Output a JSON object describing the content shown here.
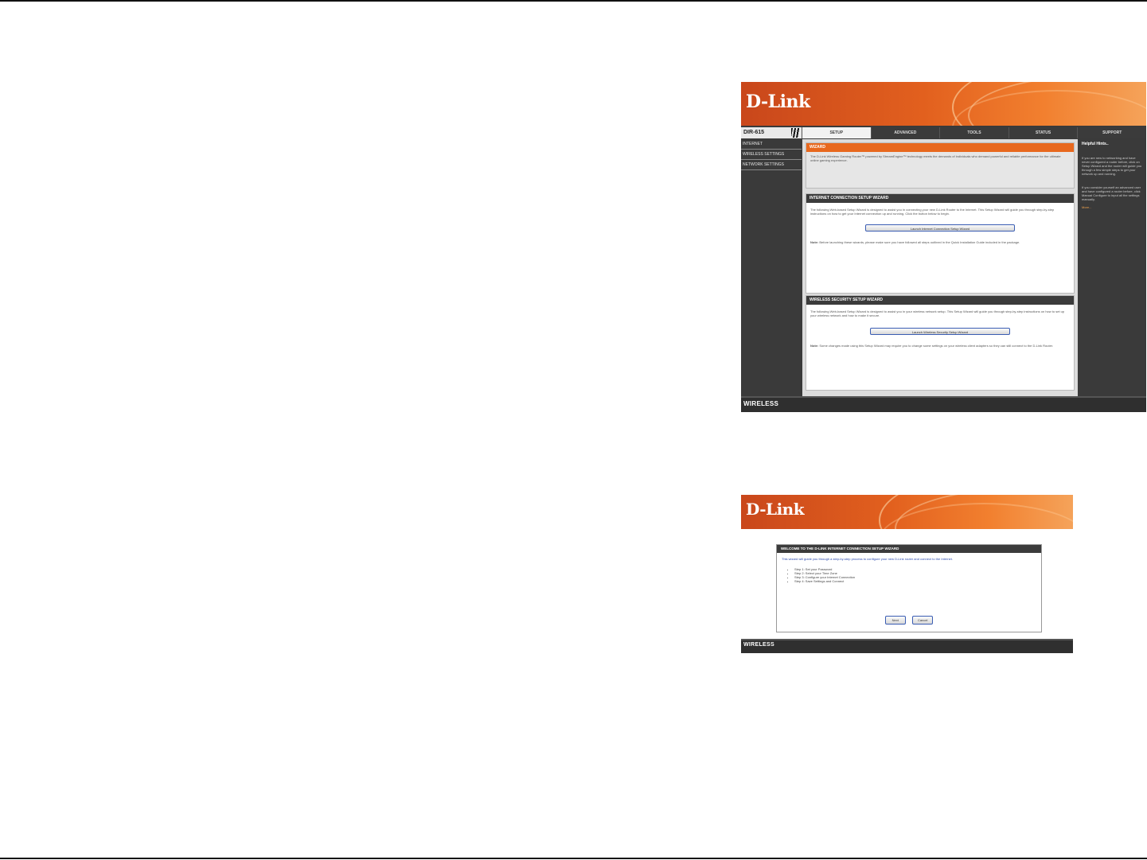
{
  "screenshot_1": {
    "brand": "D-Link",
    "model": "DIR-615",
    "tabs": [
      "SETUP",
      "ADVANCED",
      "TOOLS",
      "STATUS",
      "SUPPORT"
    ],
    "active_tab": "SETUP",
    "sidebar": [
      "INTERNET",
      "WIRELESS SETTINGS",
      "NETWORK SETTINGS"
    ],
    "wizard": {
      "title": "WIZARD",
      "text": "The D-Link Wireless Gaming Router™ powered by StreamEngine™ technology meets the demands of individuals who demand powerful and reliable performance for the ultimate online gaming experience."
    },
    "internet_wizard": {
      "title": "INTERNET CONNECTION SETUP WIZARD",
      "text": "The following Web-based Setup Wizard is designed to assist you in connecting your new D-Link Router to the Internet. This Setup Wizard will guide you through step-by-step instructions on how to get your Internet connection up and running. Click the button below to begin.",
      "button": "Launch Internet Connection Setup Wizard",
      "note_label": "Note:",
      "note": "Before launching these wizards, please make sure you have followed all steps outlined in the Quick Installation Guide included in the package."
    },
    "wireless_wizard": {
      "title": "WIRELESS SECURITY SETUP WIZARD",
      "text": "The following Web-based Setup Wizard is designed to assist you in your wireless network setup. This Setup Wizard will guide you through step-by-step instructions on how to set up your wireless network and how to make it secure.",
      "button": "Launch Wireless Security Setup Wizard",
      "note_label": "Note:",
      "note": "Some changes made using this Setup Wizard may require you to change some settings on your wireless client adapters so they can still connect to the D-Link Router."
    },
    "helpful_hints": {
      "title": "Helpful Hints..",
      "p1": "If you are new to networking and have never configured a router before, click on Setup Wizard and the router will guide you through a few simple steps to get your network up and running.",
      "p2": "If you consider yourself an advanced user and have configured a router before, click Manual Configure to input all the settings manually.",
      "more": "More..."
    },
    "footer": "WIRELESS"
  },
  "screenshot_2": {
    "brand": "D-Link",
    "dialog_title": "WELCOME TO THE D-LINK INTERNET CONNECTION SETUP WIZARD",
    "intro": "This wizard will guide you through a step-by-step process to configure your new D-Link router and connect to the Internet.",
    "steps": [
      "Step 1: Set your Password",
      "Step 2: Select your Time Zone",
      "Step 3: Configure your Internet Connection",
      "Step 4: Save Settings and Connect"
    ],
    "next_button": "Next",
    "cancel_button": "Cancel",
    "footer": "WIRELESS"
  }
}
